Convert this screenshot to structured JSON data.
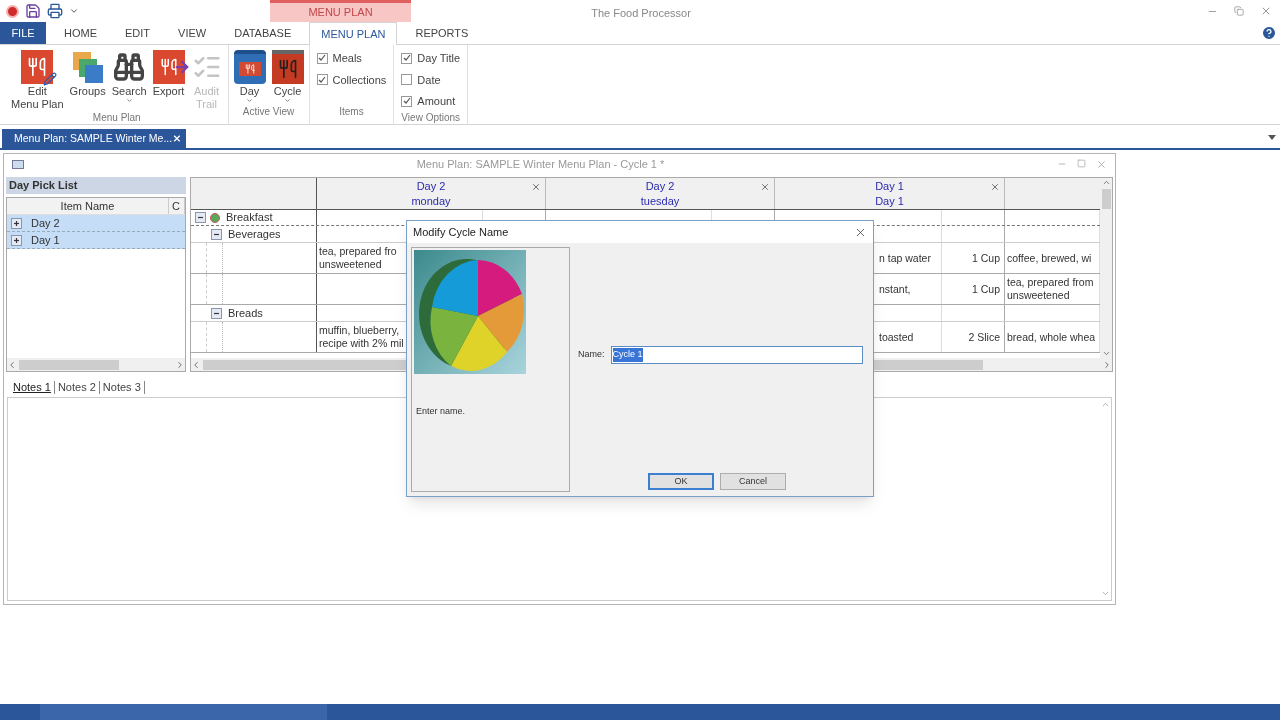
{
  "app": {
    "title": "The Food Processor",
    "contextual_group": "MENU PLAN"
  },
  "ribbon_tabs": [
    {
      "label": "FILE",
      "kind": "file",
      "selected": false
    },
    {
      "label": "HOME",
      "kind": "tab",
      "selected": false
    },
    {
      "label": "EDIT",
      "kind": "tab",
      "selected": false
    },
    {
      "label": "VIEW",
      "kind": "tab",
      "selected": false
    },
    {
      "label": "DATABASE",
      "kind": "tab",
      "selected": false
    },
    {
      "label": "MENU PLAN",
      "kind": "tab",
      "selected": true
    },
    {
      "label": "REPORTS",
      "kind": "tab",
      "selected": false
    }
  ],
  "ribbon_groups": [
    {
      "label": "Menu Plan",
      "kind": "buttons",
      "buttons": [
        {
          "lines": [
            "Edit",
            "Menu Plan"
          ],
          "dropdown": false,
          "disabled": false
        },
        {
          "lines": [
            "Groups"
          ],
          "dropdown": false,
          "disabled": false
        },
        {
          "lines": [
            "Search"
          ],
          "dropdown": true,
          "disabled": false
        },
        {
          "lines": [
            "Export"
          ],
          "dropdown": false,
          "disabled": false
        },
        {
          "lines": [
            "Audit",
            "Trail"
          ],
          "dropdown": false,
          "disabled": true
        }
      ]
    },
    {
      "label": "Active View",
      "kind": "buttons",
      "buttons": [
        {
          "lines": [
            "Day"
          ],
          "dropdown": true,
          "disabled": false
        },
        {
          "lines": [
            "Cycle"
          ],
          "dropdown": true,
          "disabled": false
        }
      ]
    },
    {
      "label": "Items",
      "kind": "checks",
      "items": [
        {
          "label": "Meals",
          "checked": true
        },
        {
          "label": "Collections",
          "checked": true
        }
      ]
    },
    {
      "label": "View Options",
      "kind": "checks",
      "items": [
        {
          "label": "Day Title",
          "checked": true
        },
        {
          "label": "Date",
          "checked": false
        },
        {
          "label": "Amount",
          "checked": true
        }
      ]
    }
  ],
  "document_tab": {
    "label": "Menu Plan: SAMPLE Winter Me...",
    "selected": true
  },
  "child_window": {
    "title": "Menu Plan: SAMPLE Winter Menu Plan - Cycle 1 *"
  },
  "day_pick_list": {
    "title": "Day Pick List",
    "columns": [
      "Item Name",
      "C"
    ],
    "rows": [
      {
        "label": "Day 2",
        "selected": true,
        "expanded": false
      },
      {
        "label": "Day 1",
        "selected": true,
        "expanded": false
      }
    ]
  },
  "grid": {
    "columns": [
      {
        "title": "Day 2",
        "subtitle": "monday"
      },
      {
        "title": "Day 2",
        "subtitle": "tuesday"
      },
      {
        "title": "Day 1",
        "subtitle": "Day 1"
      }
    ],
    "rows": [
      {
        "kind": "meal",
        "label": "Breakfast",
        "expanded": true
      },
      {
        "kind": "group",
        "label": "Beverages",
        "expanded": true
      },
      {
        "kind": "item",
        "cells": {
          "monday_food": [
            "tea, prepared fro",
            "unsweetened"
          ],
          "day1_food": [
            "n tap water"
          ],
          "day1_amount": [
            "1 Cup"
          ],
          "next_food": [
            "coffee, brewed, wi"
          ]
        }
      },
      {
        "kind": "item",
        "cells": {
          "day1_food": [
            "nstant,"
          ],
          "day1_amount": [
            "1 Cup"
          ],
          "next_food": [
            "tea, prepared from",
            "unsweetened"
          ]
        }
      },
      {
        "kind": "group",
        "label": "Breads",
        "expanded": true
      },
      {
        "kind": "item",
        "cells": {
          "monday_food": [
            "muffin, blueberry,",
            "recipe with 2% mil"
          ],
          "day1_food": [
            "toasted"
          ],
          "day1_amount": [
            "2 Slice"
          ],
          "next_food": [
            "bread, whole whea"
          ]
        }
      }
    ]
  },
  "notes_tabs": [
    {
      "label": "Notes 1",
      "selected": true
    },
    {
      "label": "Notes 2",
      "selected": false
    },
    {
      "label": "Notes 3",
      "selected": false
    }
  ],
  "dialog": {
    "title": "Modify Cycle Name",
    "hint": "Enter name.",
    "name_label": "Name:",
    "name_field": {
      "value": "Cycle 1",
      "text_selected": true
    },
    "buttons": [
      {
        "label": "OK",
        "default": true
      },
      {
        "label": "Cancel",
        "default": false
      }
    ]
  }
}
